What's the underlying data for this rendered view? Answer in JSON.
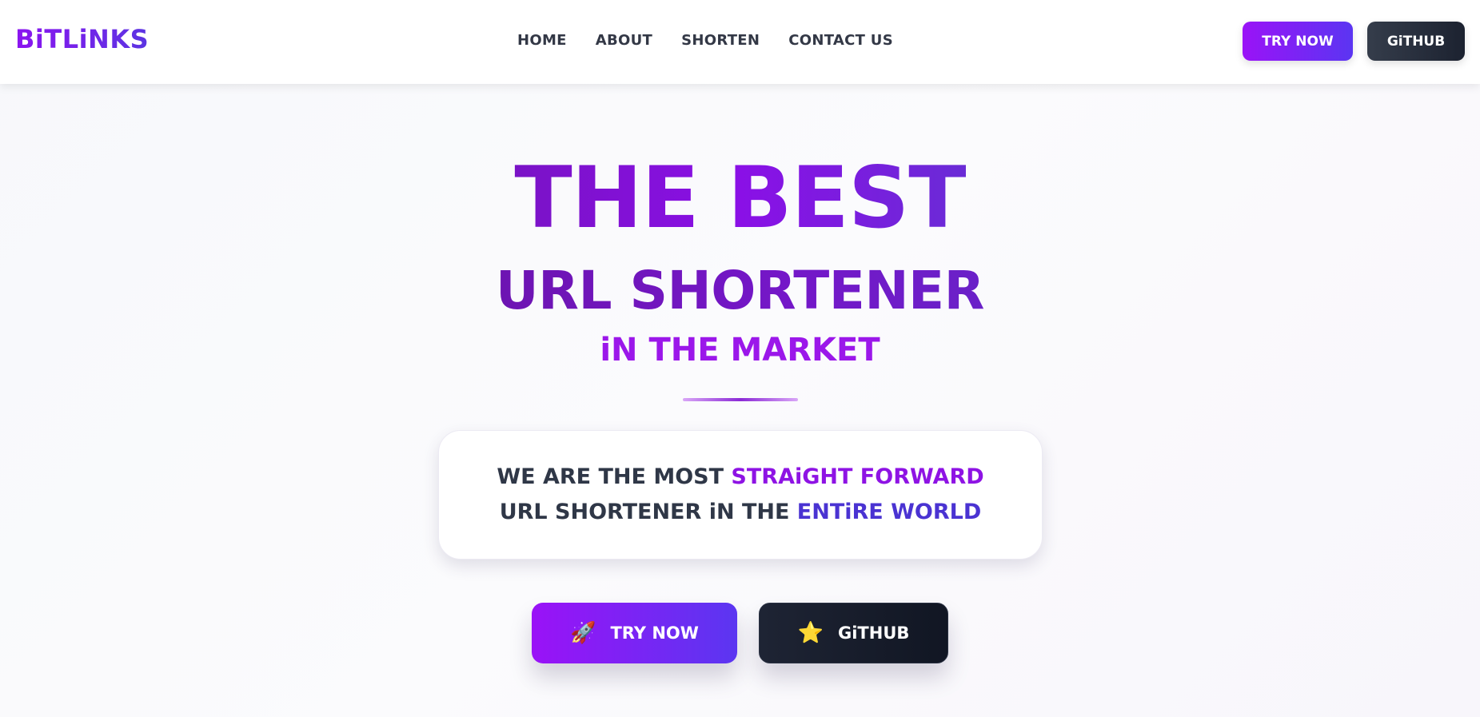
{
  "brand": {
    "logo": "BiTLiNKS"
  },
  "nav": {
    "links": [
      "HOME",
      "ABOUT",
      "SHORTEN",
      "CONTACT US"
    ],
    "try_label": "TRY NOW",
    "github_label": "GiTHUB"
  },
  "hero": {
    "title_line1": "THE BEST",
    "title_line2": "URL SHORTENER",
    "title_line3": "iN THE MARKET",
    "tagline": {
      "part1": "WE ARE THE MOST ",
      "highlight1": "STRAiGHT FORWARD",
      "part2": " URL SHORTENER iN THE ",
      "highlight2": "ENTiRE WORLD"
    },
    "cta_try": {
      "icon": "rocket-icon",
      "glyph": "🚀",
      "label": "TRY NOW"
    },
    "cta_github": {
      "icon": "star-icon",
      "glyph": "⭐",
      "label": "GiTHUB"
    }
  },
  "colors": {
    "accent_purple": "#8e13e4",
    "accent_indigo": "#4a33d2",
    "dark": "#1c2230"
  }
}
